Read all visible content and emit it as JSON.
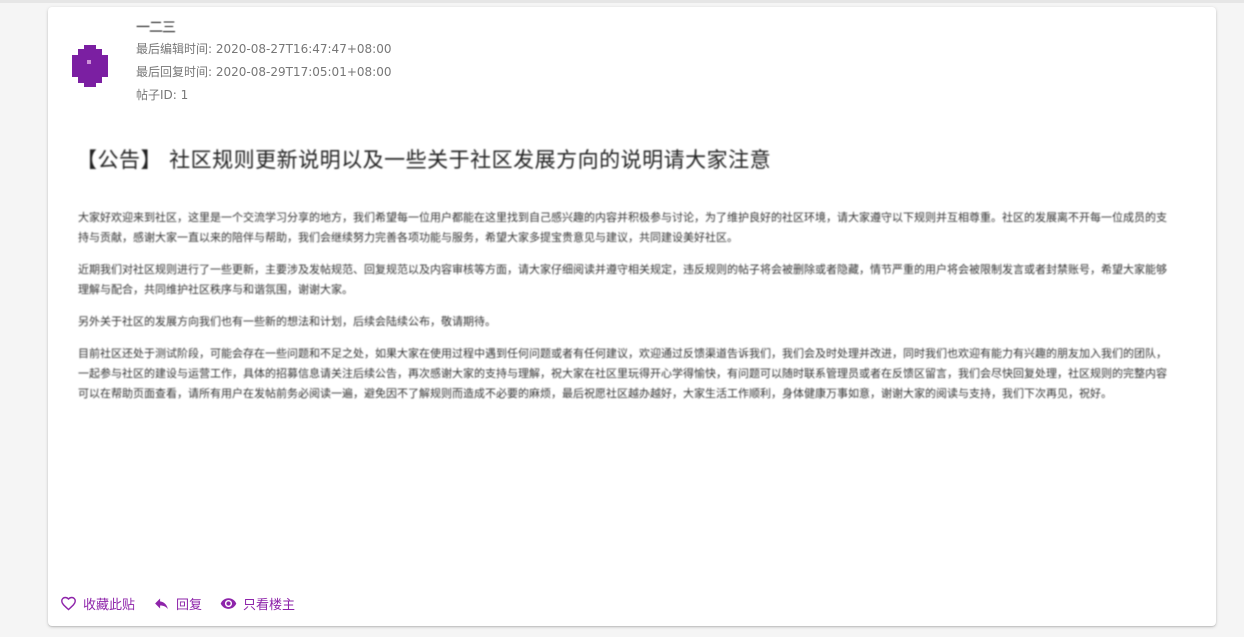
{
  "post": {
    "author": "一二三",
    "last_edit_label": "最后编辑时间: ",
    "last_edit_time": "2020-08-27T16:47:47+08:00",
    "last_reply_label": "最后回复时间: ",
    "last_reply_time": "2020-08-29T17:05:01+08:00",
    "post_id_label": "帖子ID: ",
    "post_id": "1",
    "title": "【公告】 社区规则更新说明以及一些关于社区发展方向的说明请大家注意",
    "paragraphs": [
      "大家好欢迎来到社区，这里是一个交流学习分享的地方，我们希望每一位用户都能在这里找到自己感兴趣的内容并积极参与讨论，为了维护良好的社区环境，请大家遵守以下规则并互相尊重。社区的发展离不开每一位成员的支持与贡献，感谢大家一直以来的陪伴与帮助，我们会继续努力完善各项功能与服务，希望大家多提宝贵意见与建议，共同建设美好社区。",
      "近期我们对社区规则进行了一些更新，主要涉及发帖规范、回复规范以及内容审核等方面，请大家仔细阅读并遵守相关规定，违反规则的帖子将会被删除或者隐藏，情节严重的用户将会被限制发言或者封禁账号，希望大家能够理解与配合，共同维护社区秩序与和谐氛围，谢谢大家。",
      "另外关于社区的发展方向我们也有一些新的想法和计划，后续会陆续公布，敬请期待。",
      "目前社区还处于测试阶段，可能会存在一些问题和不足之处，如果大家在使用过程中遇到任何问题或者有任何建议，欢迎通过反馈渠道告诉我们，我们会及时处理并改进，同时我们也欢迎有能力有兴趣的朋友加入我们的团队，一起参与社区的建设与运营工作，具体的招募信息请关注后续公告，再次感谢大家的支持与理解，祝大家在社区里玩得开心学得愉快，有问题可以随时联系管理员或者在反馈区留言，我们会尽快回复处理，社区规则的完整内容可以在帮助页面查看，请所有用户在发帖前务必阅读一遍，避免因不了解规则而造成不必要的麻烦，最后祝愿社区越办越好，大家生活工作顺利，身体健康万事如意，谢谢大家的阅读与支持，我们下次再见，祝好。"
    ]
  },
  "actions": {
    "favorite": "收藏此贴",
    "reply": "回复",
    "op_only": "只看楼主"
  },
  "colors": {
    "accent": "#8e24aa",
    "avatar": "#7b1fa2",
    "meta_text": "#777777"
  },
  "icons": {
    "favorite": "heart-outline-icon",
    "reply": "reply-arrow-icon",
    "op_only": "eye-icon"
  }
}
